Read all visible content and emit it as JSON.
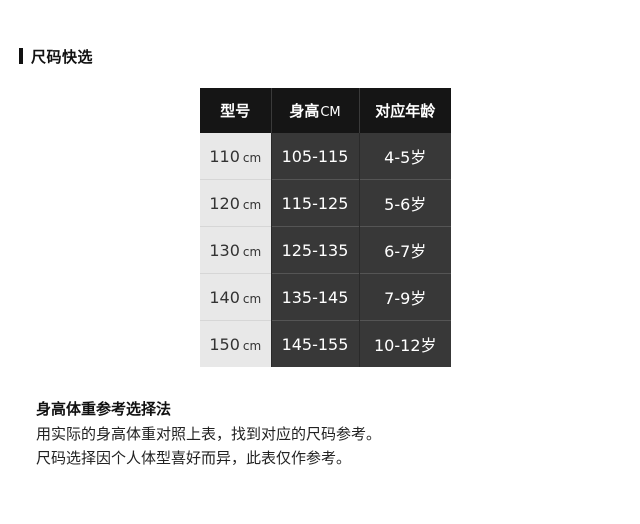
{
  "section": {
    "title": "尺码快选"
  },
  "table": {
    "headers": {
      "model": "型号",
      "height": "身高",
      "height_unit": "CM",
      "age": "对应年龄"
    },
    "rows": [
      {
        "model": "110",
        "model_unit": "cm",
        "height": "105-115",
        "age": "4-5岁"
      },
      {
        "model": "120",
        "model_unit": "cm",
        "height": "115-125",
        "age": "5-6岁"
      },
      {
        "model": "130",
        "model_unit": "cm",
        "height": "125-135",
        "age": "6-7岁"
      },
      {
        "model": "140",
        "model_unit": "cm",
        "height": "135-145",
        "age": "7-9岁"
      },
      {
        "model": "150",
        "model_unit": "cm",
        "height": "145-155",
        "age": "10-12岁"
      }
    ]
  },
  "method": {
    "title": "身高体重参考选择法",
    "line1": "用实际的身高体重对照上表，找到对应的尺码参考。",
    "line2": "尺码选择因个人体型喜好而异，此表仅作参考。"
  },
  "colors": {
    "header_bg": "#151515",
    "model_cell_bg": "#e8e8e8",
    "data_cell_bg": "#383838"
  }
}
